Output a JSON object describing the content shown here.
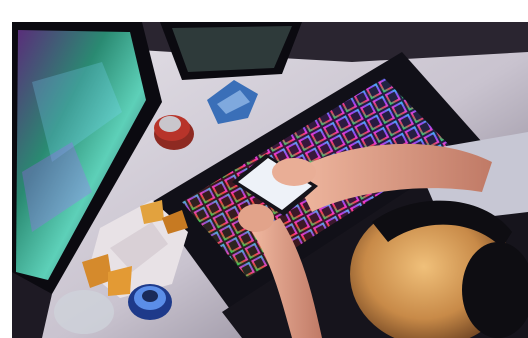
{
  "photo": {
    "subject": "gamer-desk-top-view",
    "colors": {
      "background": "#ffffff",
      "desk": "#d9d6dc",
      "deskShadow": "#8f8798",
      "monitorFrame": "#0b0a10",
      "keyboardBody": "#111018",
      "phoneScreen": "#eef2f8",
      "skin": "#e0a08a",
      "hair": "#d8a060",
      "headset": "#0e0d12",
      "shirt": "#c7c7d4",
      "can": "#b8342a"
    },
    "icons": [
      "monitor-icon",
      "keyboard-icon",
      "phone-icon",
      "can-icon",
      "snack-bag-icon"
    ]
  }
}
